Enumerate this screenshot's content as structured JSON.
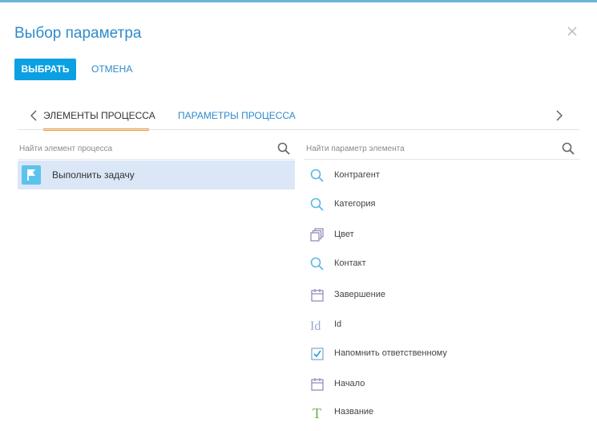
{
  "dialog": {
    "title": "Выбор параметра",
    "select_label": "ВЫБРАТЬ",
    "cancel_label": "ОТМЕНА"
  },
  "tabs": [
    {
      "label": "ЭЛЕМЕНТЫ ПРОЦЕССА",
      "active": true
    },
    {
      "label": "ПАРАМЕТРЫ ПРОЦЕССА",
      "active": false
    }
  ],
  "left": {
    "search_placeholder": "Найти элемент процесса",
    "items": [
      {
        "label": "Выполнить задачу",
        "icon": "flag-icon"
      }
    ]
  },
  "right": {
    "search_placeholder": "Найти параметр элемента",
    "params": [
      {
        "label": "Контрагент",
        "icon": "lookup-icon"
      },
      {
        "label": "Категория",
        "icon": "lookup-icon"
      },
      {
        "label": "Цвет",
        "icon": "color-icon"
      },
      {
        "label": "Контакт",
        "icon": "lookup-icon"
      },
      {
        "label": "Завершение",
        "icon": "calendar-icon"
      },
      {
        "label": "Id",
        "icon": "id-icon"
      },
      {
        "label": "Напомнить ответственному",
        "icon": "checkbox-icon"
      },
      {
        "label": "Начало",
        "icon": "calendar-icon"
      },
      {
        "label": "Название",
        "icon": "text-icon"
      }
    ]
  },
  "colors": {
    "accent": "#0aa0e2",
    "link": "#2e8bcc",
    "tab_underline": "#f39c3c",
    "selected_row": "#dbe6f7",
    "top_bar": "#6cb4d6"
  }
}
